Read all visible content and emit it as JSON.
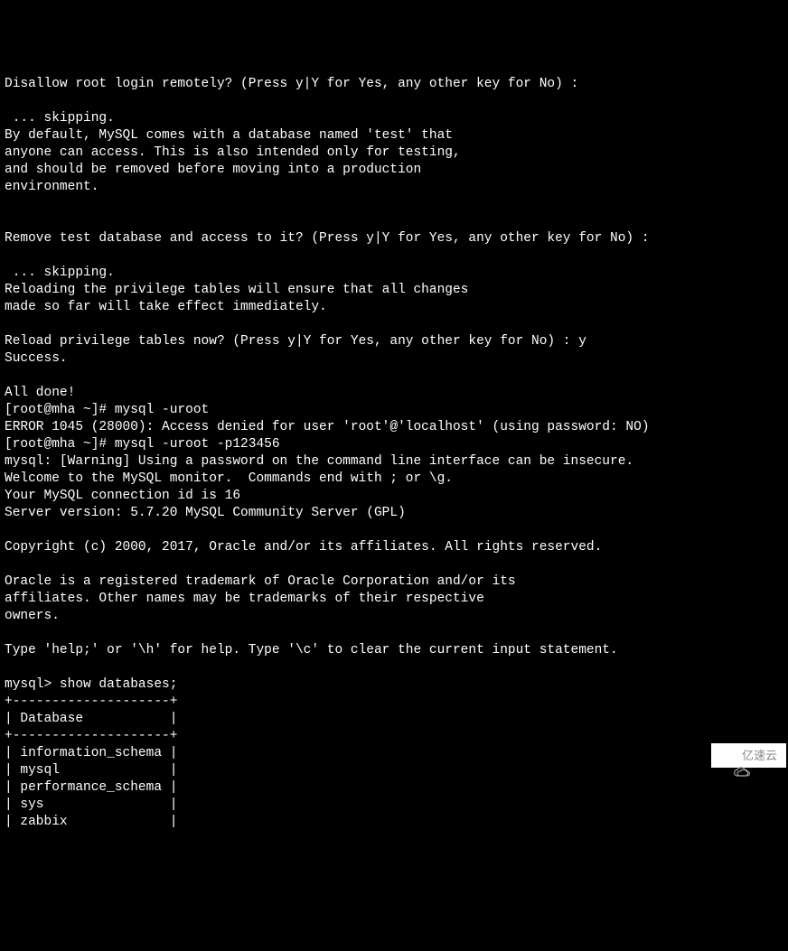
{
  "terminal": {
    "lines": [
      "Disallow root login remotely? (Press y|Y for Yes, any other key for No) :",
      "",
      " ... skipping.",
      "By default, MySQL comes with a database named 'test' that",
      "anyone can access. This is also intended only for testing,",
      "and should be removed before moving into a production",
      "environment.",
      "",
      "",
      "Remove test database and access to it? (Press y|Y for Yes, any other key for No) :",
      "",
      " ... skipping.",
      "Reloading the privilege tables will ensure that all changes",
      "made so far will take effect immediately.",
      "",
      "Reload privilege tables now? (Press y|Y for Yes, any other key for No) : y",
      "Success.",
      "",
      "All done!",
      "[root@mha ~]# mysql -uroot",
      "ERROR 1045 (28000): Access denied for user 'root'@'localhost' (using password: NO)",
      "[root@mha ~]# mysql -uroot -p123456",
      "mysql: [Warning] Using a password on the command line interface can be insecure.",
      "Welcome to the MySQL monitor.  Commands end with ; or \\g.",
      "Your MySQL connection id is 16",
      "Server version: 5.7.20 MySQL Community Server (GPL)",
      "",
      "Copyright (c) 2000, 2017, Oracle and/or its affiliates. All rights reserved.",
      "",
      "Oracle is a registered trademark of Oracle Corporation and/or its",
      "affiliates. Other names may be trademarks of their respective",
      "owners.",
      "",
      "Type 'help;' or '\\h' for help. Type '\\c' to clear the current input statement.",
      "",
      "mysql> show databases;",
      "+--------------------+",
      "| Database           |",
      "+--------------------+",
      "| information_schema |",
      "| mysql              |",
      "| performance_schema |",
      "| sys                |",
      "| zabbix             |"
    ]
  },
  "watermark": {
    "text": "亿速云"
  }
}
